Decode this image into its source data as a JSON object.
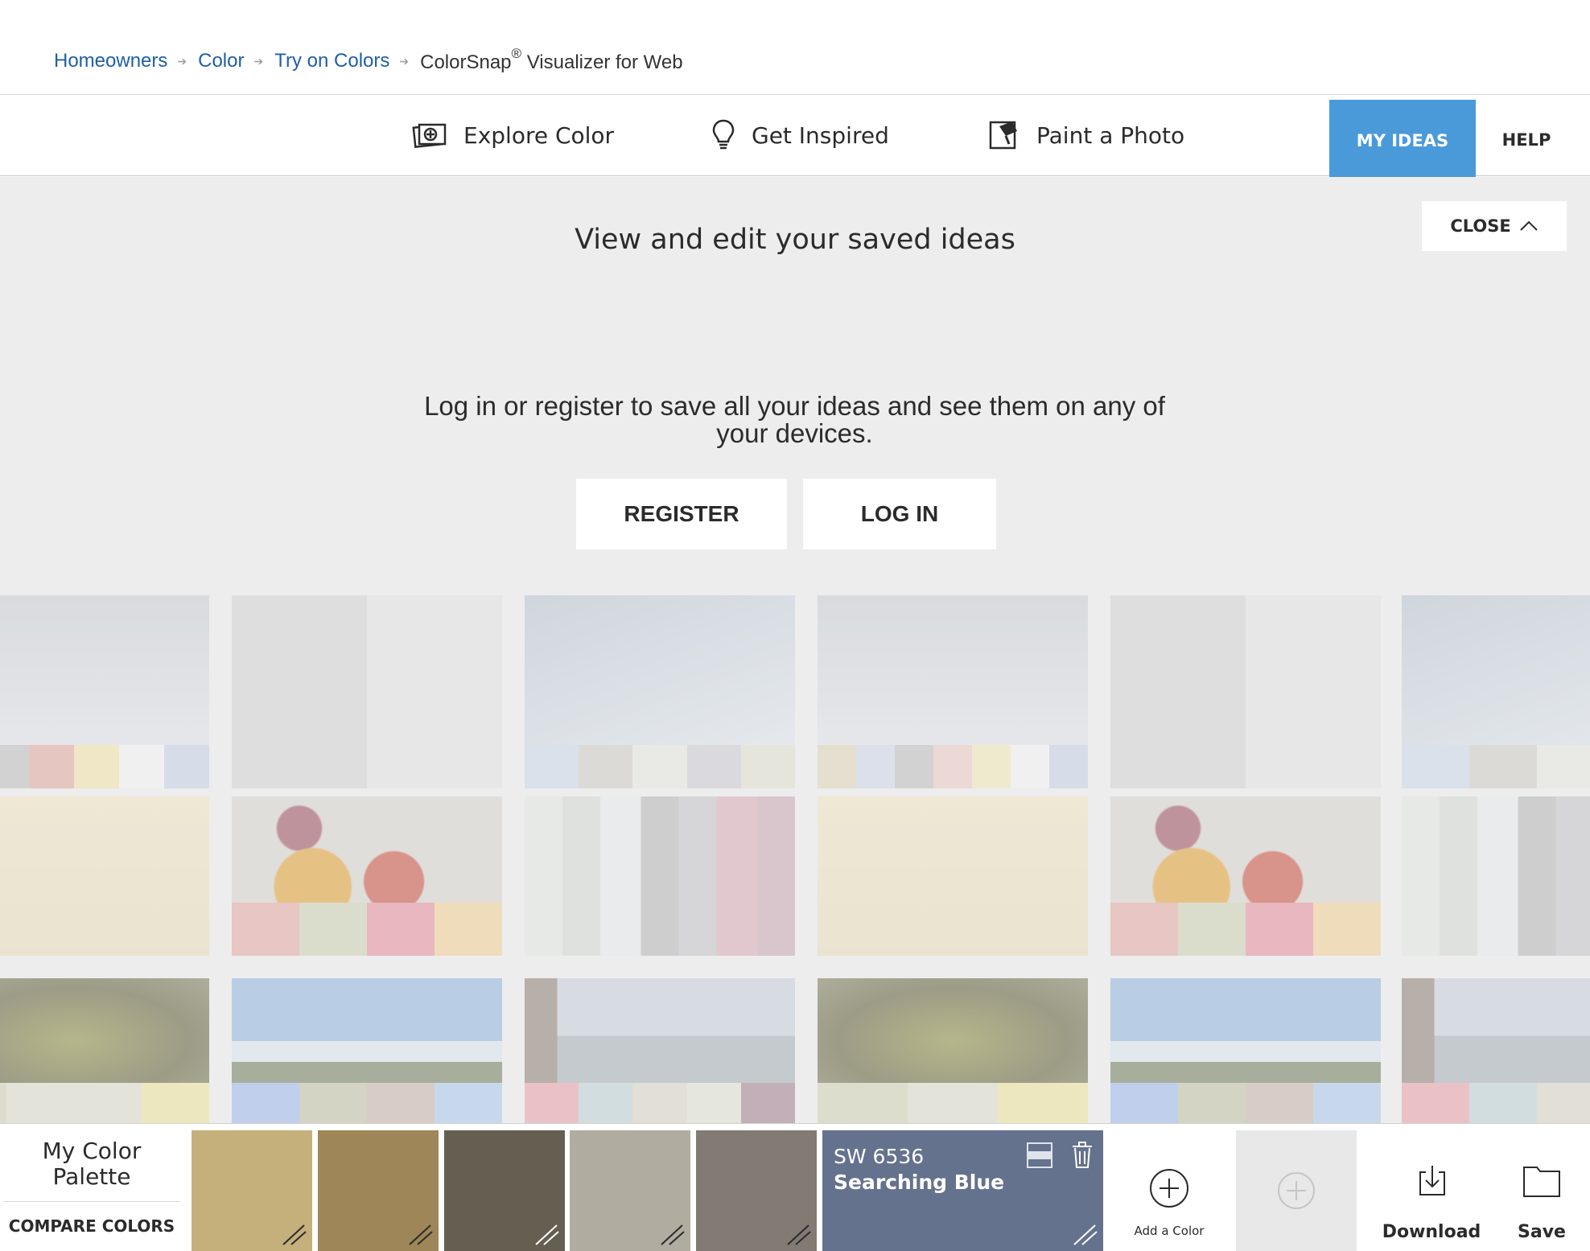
{
  "breadcrumb": {
    "items": [
      "Homeowners",
      "Color",
      "Try on Colors"
    ],
    "current": "ColorSnap",
    "current_sup": "®",
    "current_rest": " Visualizer for Web"
  },
  "nav": {
    "explore": "Explore Color",
    "inspired": "Get Inspired",
    "paint": "Paint a Photo",
    "my_ideas": "MY IDEAS",
    "help": "HELP"
  },
  "panel": {
    "close": "CLOSE",
    "title": "View and edit your saved ideas",
    "login_message": "Log in or register to save all your ideas and see them on any of your devices.",
    "register": "REGISTER",
    "login": "LOG IN"
  },
  "palette": {
    "title": "My Color Palette",
    "compare": "COMPARE COLORS",
    "chips": [
      "#c5b07c",
      "#9f8658",
      "#655f51",
      "#b0aca0",
      "#817b74"
    ],
    "active": {
      "code": "SW 6536",
      "name": "Searching Blue",
      "color": "#65728d"
    },
    "add_color": "Add a Color",
    "download": "Download",
    "save": "Save"
  },
  "colors": {
    "accent": "#4a9ada",
    "link": "#1f5fa8",
    "panel_bg": "#ededed"
  }
}
